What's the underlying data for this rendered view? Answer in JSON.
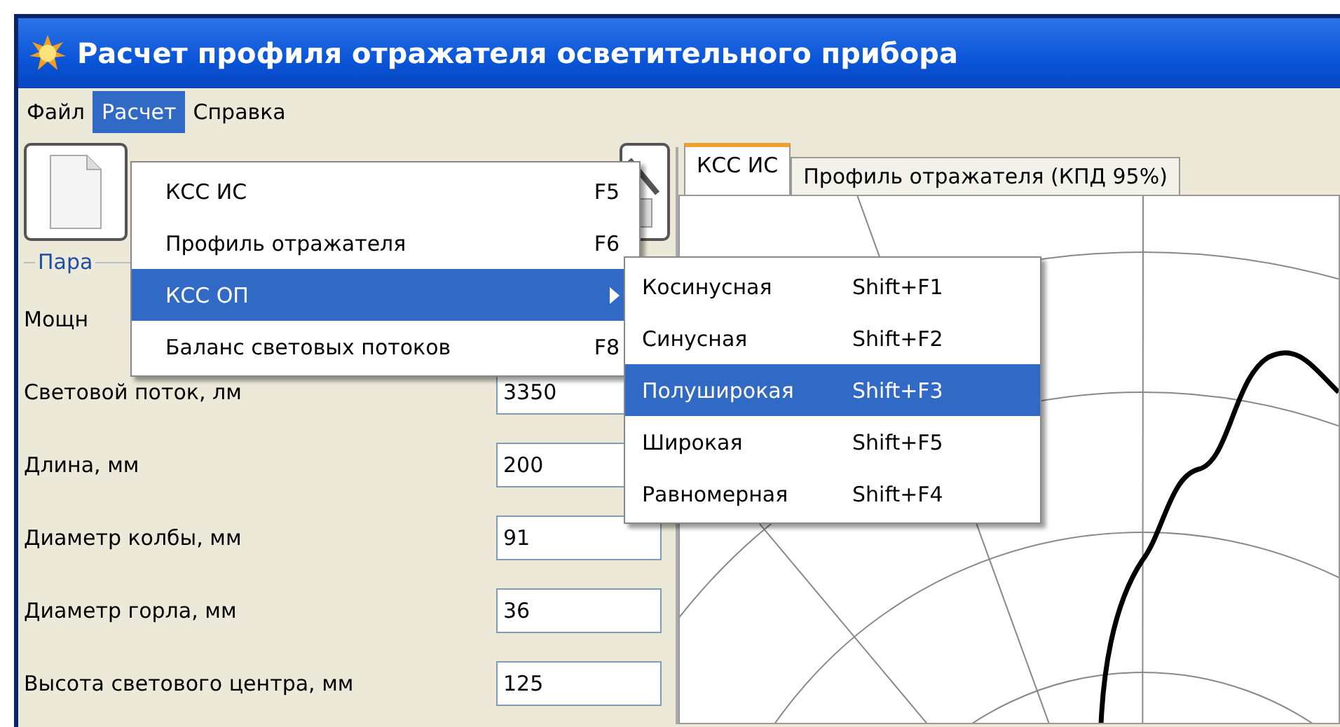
{
  "window": {
    "title": "Расчет профиля отражателя осветительного прибора"
  },
  "menu_bar": [
    {
      "label": "Файл",
      "selected": false
    },
    {
      "label": "Расчет",
      "selected": true
    },
    {
      "label": "Справка",
      "selected": false
    }
  ],
  "group_box": {
    "title": "Пара"
  },
  "fields": [
    {
      "label": "Мощн"
    },
    {
      "label": "Световой поток, лм",
      "value": "3350"
    },
    {
      "label": "Длина, мм",
      "value": "200"
    },
    {
      "label": "Диаметр колбы, мм",
      "value": "91"
    },
    {
      "label": "Диаметр горла, мм",
      "value": "36"
    },
    {
      "label": "Высота светового центра, мм",
      "value": "125"
    }
  ],
  "tabs": [
    {
      "label": "КСС ИС",
      "selected": true
    },
    {
      "label": "Профиль отражателя (КПД 95%)",
      "selected": false
    }
  ],
  "menu": [
    {
      "label": "КСС ИС",
      "shortcut": "F5",
      "submenu": false,
      "selected": false
    },
    {
      "label": "Профиль отражателя",
      "shortcut": "F6",
      "submenu": false,
      "selected": false
    },
    {
      "label": "КСС ОП",
      "submenu": true,
      "selected": true
    },
    {
      "label": "Баланс световых потоков",
      "shortcut": "F8",
      "submenu": false,
      "selected": false
    }
  ],
  "submenu": [
    {
      "label": "Косинусная",
      "shortcut": "Shift+F1",
      "selected": false
    },
    {
      "label": "Синусная",
      "shortcut": "Shift+F2",
      "selected": false
    },
    {
      "label": "Полуширокая",
      "shortcut": "Shift+F3",
      "selected": true
    },
    {
      "label": "Широкая",
      "shortcut": "Shift+F5",
      "selected": false
    },
    {
      "label": "Равномерная",
      "shortcut": "Shift+F4",
      "selected": false
    }
  ]
}
